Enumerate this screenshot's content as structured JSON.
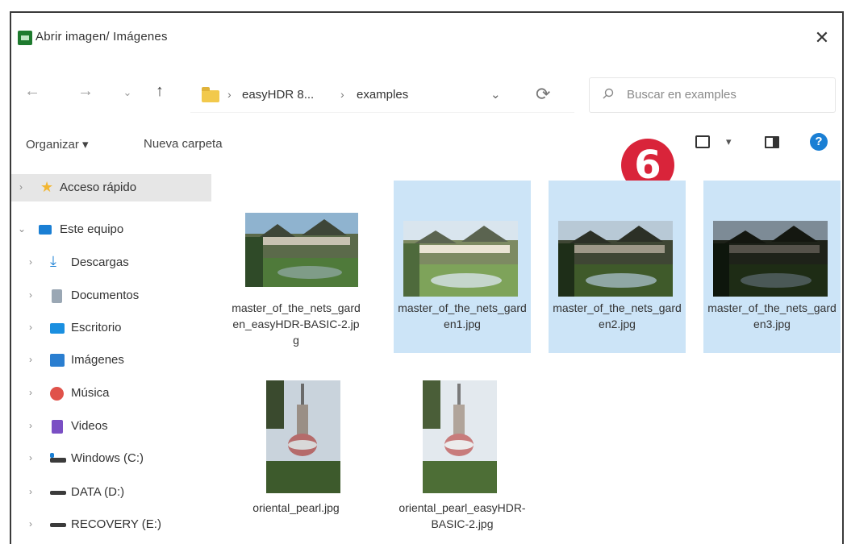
{
  "window": {
    "title": "Abrir imagen/ Imágenes"
  },
  "nav": {
    "back": "←",
    "forward": "→",
    "recent": "⌄",
    "up": "↑",
    "breadcrumb_sep0": "›",
    "crumb1": "easyHDR 8...",
    "breadcrumb_sep1": "›",
    "crumb2": "examples",
    "dropdown": "⌄",
    "refresh": "⟳"
  },
  "search": {
    "placeholder": "Buscar en examples"
  },
  "commands": {
    "organize": "Organizar ▾",
    "new_folder": "Nueva carpeta",
    "view_dropdown": "▾",
    "help": "?"
  },
  "step_marker": "6",
  "sidebar": {
    "items": [
      {
        "label": "Acceso rápido",
        "chev": "›"
      },
      {
        "label": "Este equipo",
        "chev": "⌄"
      },
      {
        "label": "Descargas",
        "chev": "›"
      },
      {
        "label": "Documentos",
        "chev": "›"
      },
      {
        "label": "Escritorio",
        "chev": "›"
      },
      {
        "label": "Imágenes",
        "chev": "›"
      },
      {
        "label": "Música",
        "chev": "›"
      },
      {
        "label": "Videos",
        "chev": "›"
      },
      {
        "label": "Windows (C:)",
        "chev": "›"
      },
      {
        "label": "DATA (D:)",
        "chev": "›"
      },
      {
        "label": "RECOVERY (E:)",
        "chev": "›"
      }
    ]
  },
  "files": [
    {
      "name": "master_of_the_nets_garden_easyHDR-BASIC-2.jpg",
      "selected": false
    },
    {
      "name": "master_of_the_nets_garden1.jpg",
      "selected": true
    },
    {
      "name": "master_of_the_nets_garden2.jpg",
      "selected": true
    },
    {
      "name": "master_of_the_nets_garden3.jpg",
      "selected": true
    },
    {
      "name": "oriental_pearl.jpg",
      "selected": false
    },
    {
      "name": "oriental_pearl_easyHDR-BASIC-2.jpg",
      "selected": false
    }
  ],
  "colors": {
    "selection": "#cce4f7",
    "accent": "#1a7fd4",
    "marker": "#d9243a"
  }
}
